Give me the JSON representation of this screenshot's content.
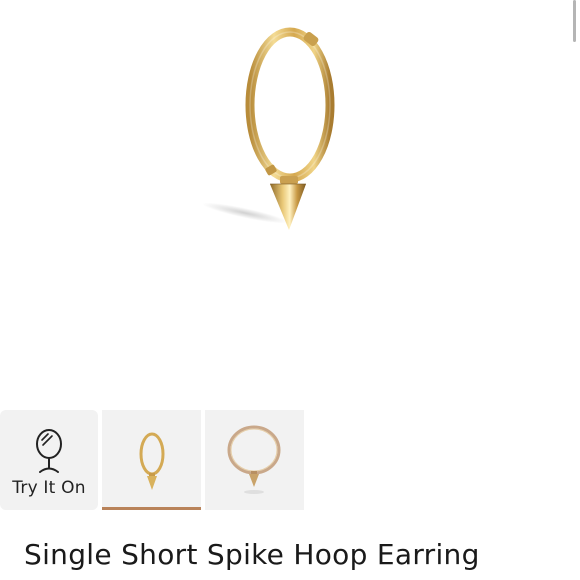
{
  "product": {
    "title": "Single Short Spike Hoop Earring"
  },
  "gallery": {
    "try_on_label": "Try It On",
    "selected_index": 1,
    "thumbnails": [
      "try-on",
      "front-view",
      "side-view"
    ]
  },
  "colors": {
    "gold": "#d9b25c",
    "selected_underline": "#b9835a",
    "thumb_bg": "#f2f2f2"
  }
}
